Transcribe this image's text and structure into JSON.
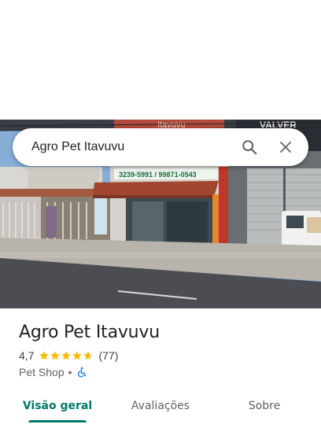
{
  "search": {
    "query": "Agro Pet Itavuvu"
  },
  "icons": {
    "search": "search-icon",
    "close": "close-icon",
    "star": "star-icon",
    "accessibility": "wheelchair-icon"
  },
  "photo": {
    "store_phone_sign": "3239-5991 / 99871-0543",
    "sign_top_left": "Itavuvu",
    "sign_top_right": "VALVER"
  },
  "place": {
    "name": "Agro Pet Itavuvu",
    "rating": "4,7",
    "rating_value": 4.7,
    "reviews_count": "(77)",
    "category": "Pet Shop",
    "separator": "•"
  },
  "tabs": [
    {
      "label": "Visão geral",
      "active": true
    },
    {
      "label": "Avaliações",
      "active": false
    },
    {
      "label": "Sobre",
      "active": false
    }
  ],
  "colors": {
    "accent": "#00796b",
    "star": "#fbbc04",
    "star_empty": "#dadce0",
    "accessibility_icon": "#1a73e8"
  }
}
